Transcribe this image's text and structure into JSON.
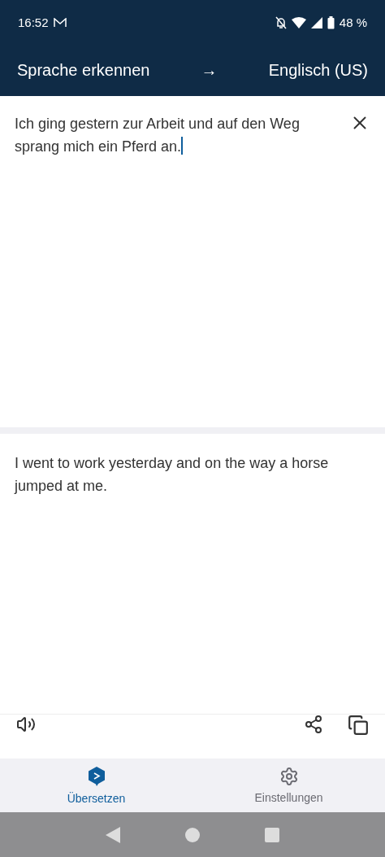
{
  "status_bar": {
    "time": "16:52",
    "battery": "48 %"
  },
  "header": {
    "source_language": "Sprache erkennen",
    "arrow": "→",
    "target_language": "Englisch (US)"
  },
  "source": {
    "value": "Ich ging gestern zur Arbeit und auf den Weg sprang mich ein Pferd an."
  },
  "translation": {
    "text": "I went to work yesterday and on the way a horse jumped at me."
  },
  "bottom_nav": [
    {
      "label": "Übersetzen",
      "kind": "translate",
      "selected": true
    },
    {
      "label": "Einstellungen",
      "kind": "settings",
      "selected": false
    }
  ]
}
